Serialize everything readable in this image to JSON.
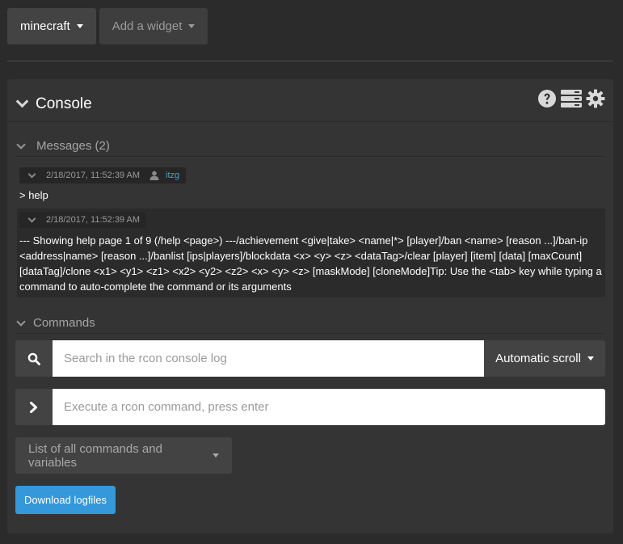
{
  "topbar": {
    "server_label": "minecraft",
    "add_widget_label": "Add a widget"
  },
  "console": {
    "title": "Console",
    "icons": [
      "help-icon",
      "list-icon",
      "gear-icon"
    ]
  },
  "messages": {
    "label": "Messages (2)",
    "items": [
      {
        "timestamp": "2/18/2017, 11:52:39 AM",
        "user": "itzg",
        "text": "> help"
      },
      {
        "timestamp": "2/18/2017, 11:52:39 AM",
        "user": "",
        "text": "--- Showing help page 1 of 9 (/help <page>) ---/achievement <give|take> <name|*> [player]/ban <name> [reason ...]/ban-ip <address|name> [reason ...]/banlist [ips|players]/blockdata <x> <y> <z> <dataTag>/clear [player] [item] [data] [maxCount] [dataTag]/clone <x1> <y1> <z1> <x2> <y2> <z2> <x> <y> <z> [maskMode] [cloneMode]Tip: Use the <tab> key while typing a command to auto-complete the command or its arguments"
      }
    ]
  },
  "commands": {
    "label": "Commands",
    "search_placeholder": "Search in the rcon console log",
    "scroll_label": "Automatic scroll",
    "execute_placeholder": "Execute a rcon command, press enter",
    "list_label": "List of all commands and variables",
    "download_label": "Download logfiles"
  },
  "colors": {
    "accent": "#3498db",
    "username": "#3aa6d8"
  }
}
